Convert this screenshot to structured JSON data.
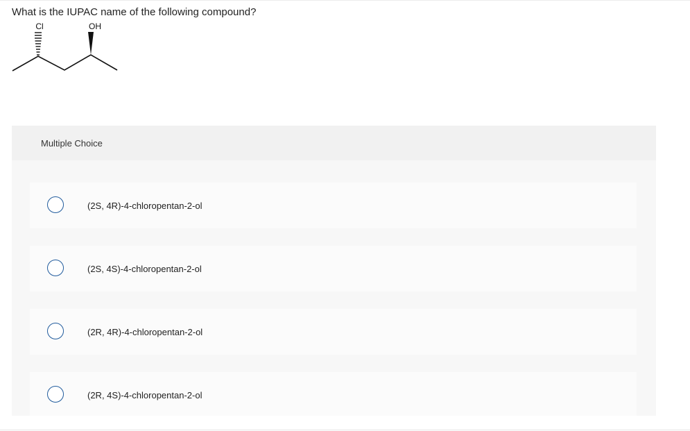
{
  "question": {
    "text": "What is the IUPAC name of the following compound?"
  },
  "structure": {
    "substituent_left": "Cl",
    "substituent_right": "OH"
  },
  "choices": {
    "header": "Multiple Choice",
    "options": [
      {
        "label": "(2S, 4R)-4-chloropentan-2-ol",
        "selected": false
      },
      {
        "label": "(2S, 4S)-4-chloropentan-2-ol",
        "selected": false
      },
      {
        "label": "(2R, 4R)-4-chloropentan-2-ol",
        "selected": false
      },
      {
        "label": "(2R, 4S)-4-chloropentan-2-ol",
        "selected": false
      }
    ]
  },
  "colors": {
    "radio_border": "#1f5a9c",
    "panel_bg": "#f7f7f7",
    "header_bg": "#f1f1f1"
  }
}
